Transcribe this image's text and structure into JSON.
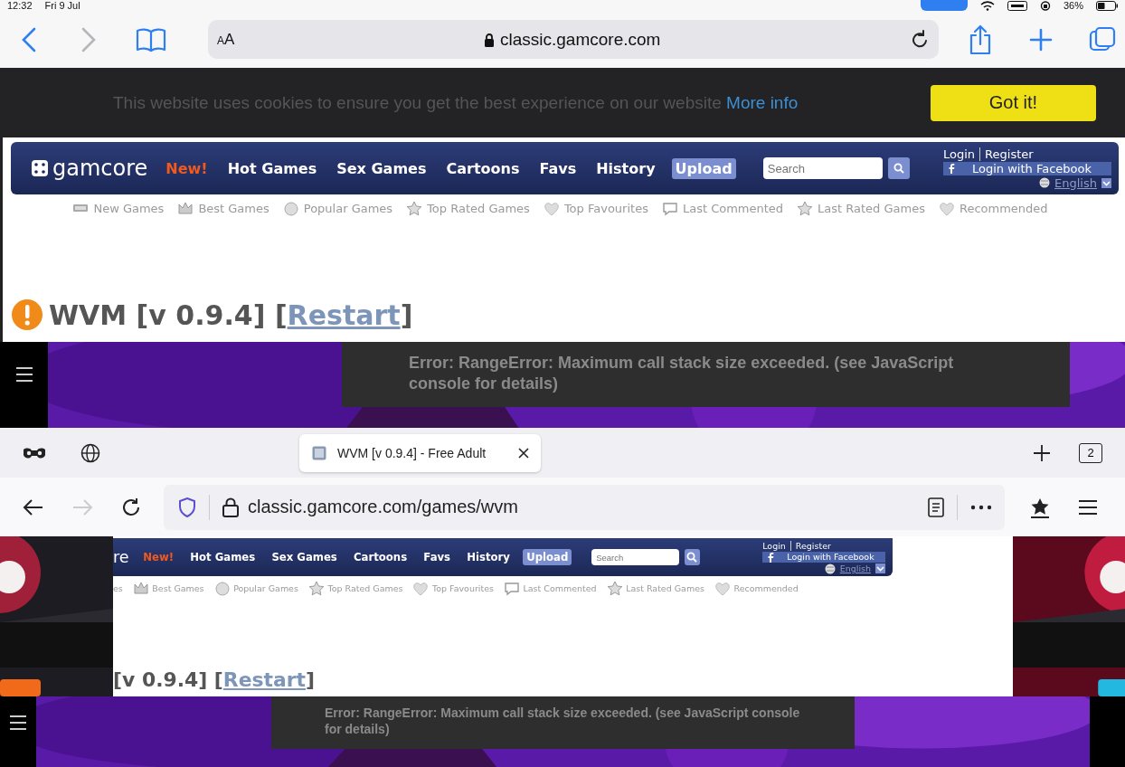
{
  "safari": {
    "status_bar": {
      "time": "12:32",
      "date": "Fri 9 Jul",
      "battery": "36%"
    },
    "text_size": "AA",
    "address": "classic.gamcore.com"
  },
  "cookie_banner": {
    "message": "This website uses cookies to ensure you get the best experience on our website",
    "link": "More info",
    "button": "Got it!"
  },
  "pages": [
    {
      "cut": false,
      "logo": "gamcore",
      "nav": [
        {
          "label": "New!",
          "kind": "new",
          "selected": false
        },
        {
          "label": "Hot Games",
          "kind": "link",
          "selected": false
        },
        {
          "label": "Sex Games",
          "kind": "link",
          "selected": false
        },
        {
          "label": "Cartoons",
          "kind": "link",
          "selected": false
        },
        {
          "label": "Favs",
          "kind": "link",
          "selected": false
        },
        {
          "label": "History",
          "kind": "link",
          "selected": false
        },
        {
          "label": "Upload",
          "kind": "link",
          "selected": true
        }
      ],
      "search_placeholder": "Search",
      "login": "Login",
      "register": "Register",
      "facebook": "Login with Facebook",
      "language": "English",
      "subnav": [
        "New Games",
        "Best Games",
        "Popular Games",
        "Top Rated Games",
        "Top Favourites",
        "Last Commented",
        "Last Rated Games",
        "Recommended"
      ],
      "title": {
        "text": "WVM [v 0.9.4] [",
        "link": "Restart",
        "end": "]"
      },
      "error": "Error: RangeError: Maximum call stack size exceeded. (see JavaScript console for details)"
    },
    {
      "cut": true,
      "logo": "re",
      "nav": [
        {
          "label": "New!",
          "kind": "new",
          "selected": false
        },
        {
          "label": "Hot Games",
          "kind": "link",
          "selected": false
        },
        {
          "label": "Sex Games",
          "kind": "link",
          "selected": false
        },
        {
          "label": "Cartoons",
          "kind": "link",
          "selected": false
        },
        {
          "label": "Favs",
          "kind": "link",
          "selected": false
        },
        {
          "label": "History",
          "kind": "link",
          "selected": false
        },
        {
          "label": "Upload",
          "kind": "link",
          "selected": true
        }
      ],
      "search_placeholder": "Search",
      "login": "Login",
      "register": "Register",
      "facebook": "Login with Facebook",
      "language": "English",
      "subnav": [
        "es",
        "Best Games",
        "Popular Games",
        "Top Rated Games",
        "Top Favourites",
        "Last Commented",
        "Last Rated Games",
        "Recommended"
      ],
      "title": {
        "text": "[v 0.9.4] [",
        "link": "Restart",
        "end": "]"
      },
      "error": "Error: RangeError: Maximum call stack size exceeded. (see JavaScript console for details)"
    }
  ],
  "firefox": {
    "tab": {
      "title": "WVM [v 0.9.4] - Free Adult ",
      "selected": true
    },
    "tab_count": "2",
    "address": "classic.gamcore.com/games/wvm"
  }
}
